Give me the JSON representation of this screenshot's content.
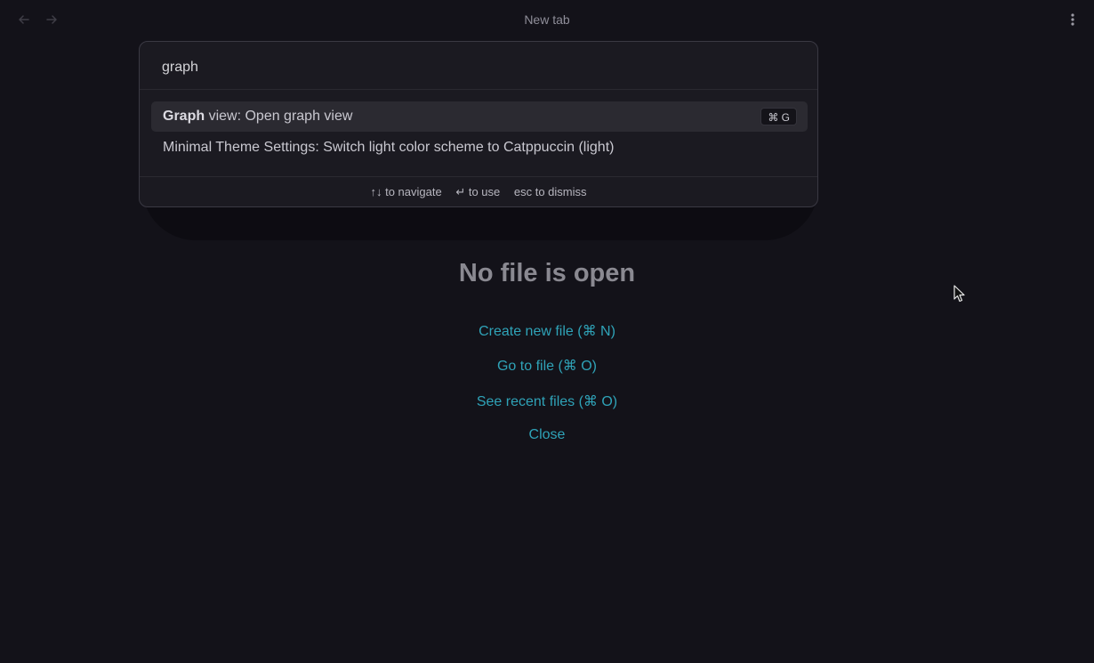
{
  "titlebar": {
    "tab_title": "New tab",
    "back_icon": "arrow-left-icon",
    "forward_icon": "arrow-right-icon",
    "more_icon": "more-vertical-icon"
  },
  "command_palette": {
    "query": "graph",
    "suggestions": [
      {
        "match": "Graph",
        "rest": " view: Open graph view",
        "hotkey": "⌘ G",
        "selected": true
      },
      {
        "match": "",
        "rest": "Minimal Theme Settings: Switch light color scheme to Catppuccin (light)",
        "hotkey": "",
        "selected": false
      }
    ],
    "footer": {
      "navigate": "↑↓ to navigate",
      "use": "↵ to use",
      "dismiss": "esc to dismiss"
    }
  },
  "empty_state": {
    "title": "No file is open",
    "actions": [
      "Create new file (⌘ N)",
      "Go to file (⌘ O)",
      "See recent files (⌘ O)",
      "Close"
    ]
  },
  "colors": {
    "background": "#131219",
    "link": "#2fa3b8",
    "palette_bg": "#1b1a21"
  }
}
